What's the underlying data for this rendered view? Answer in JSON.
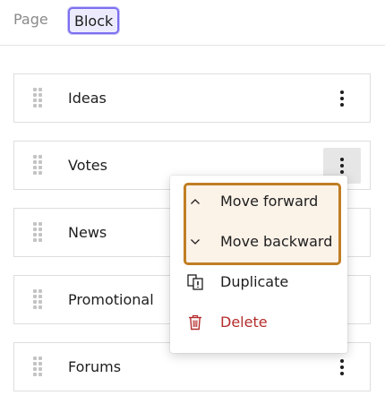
{
  "tabs": {
    "page_label": "Page",
    "block_label": "Block"
  },
  "blocks": [
    {
      "label": "Ideas"
    },
    {
      "label": "Votes"
    },
    {
      "label": "News"
    },
    {
      "label": "Promotional"
    },
    {
      "label": "Forums"
    }
  ],
  "menu": {
    "move_forward": "Move forward",
    "move_backward": "Move backward",
    "duplicate": "Duplicate",
    "delete": "Delete"
  },
  "colors": {
    "tab_active_border": "#7b6ff0",
    "menu_highlight_border": "#c07e24",
    "menu_highlight_bg": "#fbf2e8",
    "delete_color": "#b42c2c"
  }
}
